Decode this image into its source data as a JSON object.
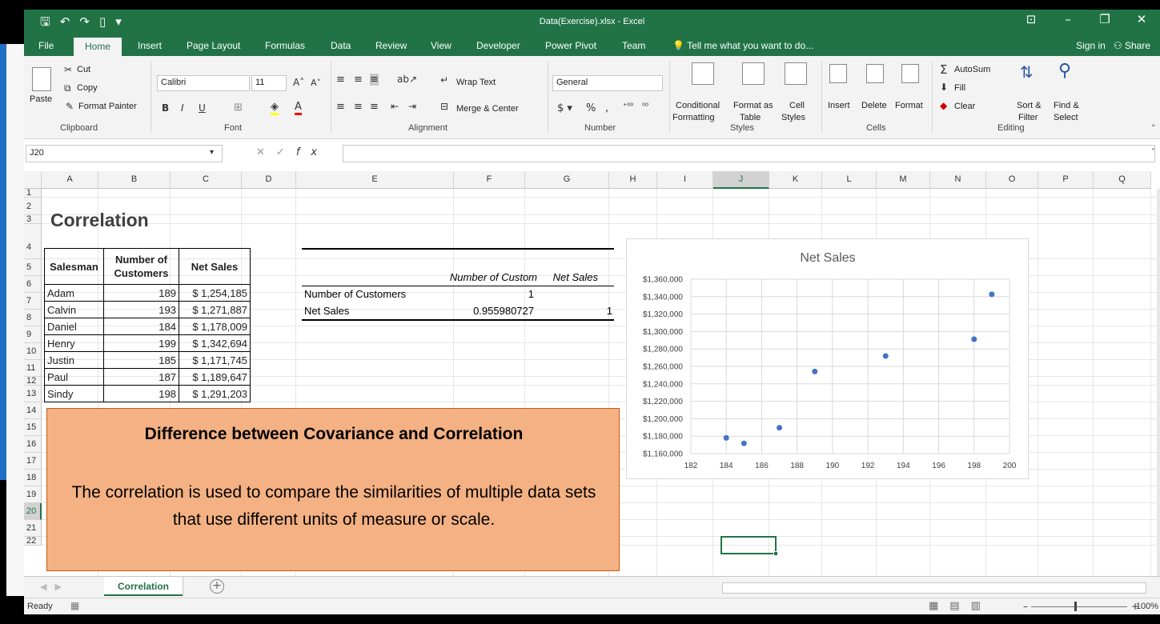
{
  "window": {
    "title": "Data(Exercise).xlsx - Excel",
    "quick_access": [
      "save-icon",
      "undo-icon",
      "redo-icon",
      "new-icon",
      "customize-icon"
    ]
  },
  "menu": {
    "tabs": [
      "File",
      "Home",
      "Insert",
      "Page Layout",
      "Formulas",
      "Data",
      "Review",
      "View",
      "Developer",
      "Power Pivot",
      "Team"
    ],
    "active": "Home",
    "tell_me": "Tell me what you want to do...",
    "sign_in": "Sign in",
    "share": "Share"
  },
  "ribbon": {
    "clipboard": {
      "paste": "Paste",
      "cut": "Cut",
      "copy": "Copy",
      "format_painter": "Format Painter",
      "label": "Clipboard"
    },
    "font": {
      "name": "Calibri",
      "size": "11",
      "label": "Font"
    },
    "alignment": {
      "wrap_text": "Wrap Text",
      "merge_center": "Merge & Center",
      "label": "Alignment"
    },
    "number": {
      "format": "General",
      "label": "Number"
    },
    "styles": {
      "conditional": "Conditional",
      "formatting": "Formatting",
      "format_as": "Format as",
      "table": "Table",
      "cell": "Cell",
      "styles_btn": "Styles",
      "label": "Styles"
    },
    "cells": {
      "insert": "Insert",
      "delete": "Delete",
      "format": "Format",
      "label": "Cells"
    },
    "editing": {
      "autosum": "AutoSum",
      "fill": "Fill",
      "clear": "Clear",
      "sort": "Sort &",
      "filter": "Filter",
      "find": "Find &",
      "select": "Select",
      "label": "Editing"
    }
  },
  "formula_bar": {
    "name_box": "J20",
    "fx": "fx",
    "content": ""
  },
  "grid": {
    "columns": [
      "A",
      "B",
      "C",
      "D",
      "E",
      "F",
      "G",
      "H",
      "I",
      "J",
      "K",
      "L",
      "M",
      "N",
      "O",
      "P",
      "Q"
    ],
    "selected_column": "J",
    "selected_row": "20",
    "rows": [
      "1",
      "2",
      "3",
      "4",
      "5",
      "6",
      "7",
      "8",
      "9",
      "10",
      "11",
      "12",
      "13",
      "14",
      "15",
      "16",
      "17",
      "18",
      "19",
      "20",
      "21",
      "22"
    ]
  },
  "sheet": {
    "title": "Correlation",
    "sales_table": {
      "headers": [
        "Salesman",
        "Number of Customers",
        "Net Sales"
      ],
      "rows": [
        [
          "Adam",
          "189",
          "$ 1,254,185"
        ],
        [
          "Calvin",
          "193",
          "$ 1,271,887"
        ],
        [
          "Daniel",
          "184",
          "$ 1,178,009"
        ],
        [
          "Henry",
          "199",
          "$ 1,342,694"
        ],
        [
          "Justin",
          "185",
          "$ 1,171,745"
        ],
        [
          "Paul",
          "187",
          "$ 1,189,647"
        ],
        [
          "Sindy",
          "198",
          "$ 1,291,203"
        ]
      ]
    },
    "correlation_table": {
      "col_headers": [
        "Number of Custom",
        "Net Sales"
      ],
      "rows": [
        {
          "label": "Number of Customers",
          "f": "1",
          "g": ""
        },
        {
          "label": "Net Sales",
          "f": "0.955980727",
          "g": "1"
        }
      ]
    },
    "note": {
      "title": "Difference between Covariance and Correlation",
      "body": "The correlation is used to compare the similarities of multiple data sets that use different units of measure or scale."
    }
  },
  "chart_data": {
    "type": "scatter",
    "title": "Net Sales",
    "x": [
      189,
      193,
      184,
      199,
      185,
      187,
      198
    ],
    "y": [
      1254185,
      1271887,
      1178009,
      1342694,
      1171745,
      1189647,
      1291203
    ],
    "xlim": [
      182,
      200
    ],
    "ylim": [
      1160000,
      1360000
    ],
    "x_ticks": [
      "182",
      "184",
      "186",
      "188",
      "190",
      "192",
      "194",
      "196",
      "198",
      "200"
    ],
    "y_ticks": [
      "$1,160,000",
      "$1,180,000",
      "$1,200,000",
      "$1,220,000",
      "$1,240,000",
      "$1,260,000",
      "$1,280,000",
      "$1,300,000",
      "$1,320,000",
      "$1,340,000",
      "$1,360,000"
    ],
    "grid": true,
    "marker_color": "#4472c4"
  },
  "sheet_tabs": {
    "active": "Correlation"
  },
  "status": {
    "ready": "Ready",
    "zoom": "100%"
  },
  "colors": {
    "excel_green": "#217346",
    "note_fill": "#f4b183",
    "note_border": "#c55a11"
  }
}
